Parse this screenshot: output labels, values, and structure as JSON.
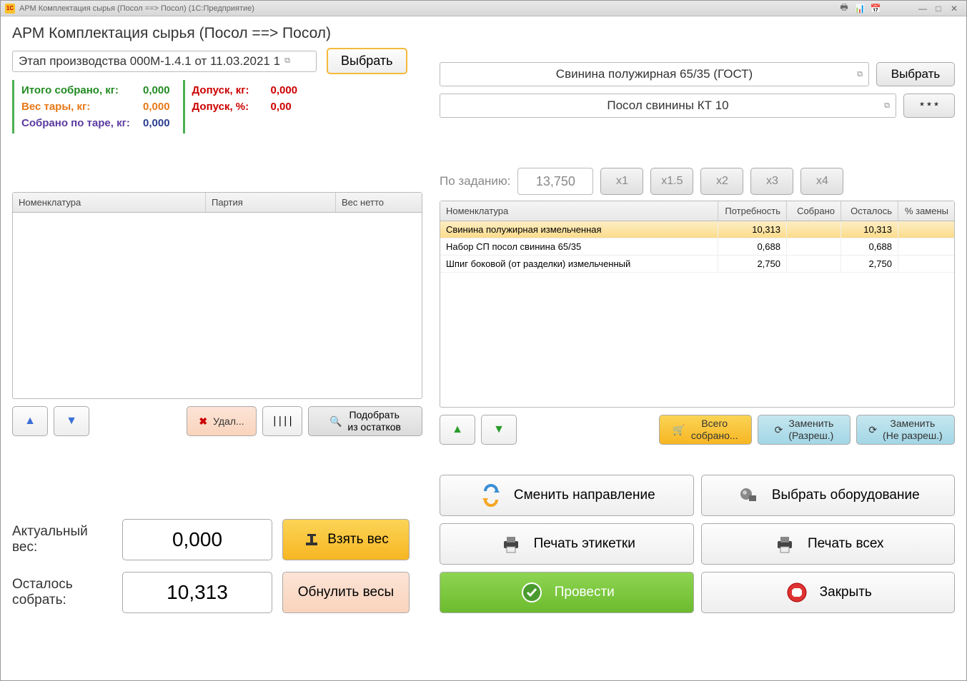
{
  "window": {
    "title": "АРМ Комплектация сырья (Посол ==> Посол)  (1С:Предприятие)"
  },
  "page": {
    "title": "АРМ Комплектация сырья (Посол ==> Посол)"
  },
  "stage": {
    "value": "Этап производства 000М-1.4.1 от 11.03.2021 1",
    "select_btn": "Выбрать"
  },
  "stats": {
    "total_label": "Итого собрано, кг:",
    "total_value": "0,000",
    "tare_label": "Вес тары, кг:",
    "tare_value": "0,000",
    "by_tare_label": "Собрано по таре, кг:",
    "by_tare_value": "0,000",
    "tol_kg_label": "Допуск, кг:",
    "tol_kg_value": "0,000",
    "tol_pct_label": "Допуск, %:",
    "tol_pct_value": "0,00"
  },
  "left_table": {
    "headers": [
      "Номенклатура",
      "Партия",
      "Вес нетто"
    ]
  },
  "left_buttons": {
    "delete": "Удал...",
    "pick": "Подобрать\nиз остатков"
  },
  "right_inputs": {
    "product": "Свинина полужирная 65/35 (ГОСТ)",
    "product_btn": "Выбрать",
    "recipe": "Посол свинины КТ 10",
    "recipe_btn": "* * *"
  },
  "task": {
    "label": "По заданию:",
    "value": "13,750",
    "mult": [
      "x1",
      "x1.5",
      "x2",
      "x3",
      "x4"
    ]
  },
  "right_table": {
    "headers": [
      "Номенклатура",
      "Потребность",
      "Собрано",
      "Осталось",
      "% замены"
    ],
    "rows": [
      {
        "n": "Свинина полужирная измельченная",
        "req": "10,313",
        "col": "",
        "rem": "10,313",
        "pct": ""
      },
      {
        "n": "Набор СП посол свинина 65/35",
        "req": "0,688",
        "col": "",
        "rem": "0,688",
        "pct": ""
      },
      {
        "n": "Шпиг боковой (от разделки) измельченный",
        "req": "2,750",
        "col": "",
        "rem": "2,750",
        "pct": ""
      }
    ]
  },
  "right_buttons": {
    "collected": "Всего\nсобрано...",
    "replace_ok": "Заменить\n(Разреш.)",
    "replace_no": "Заменить\n(Не разреш.)"
  },
  "weight": {
    "actual_label": "Актуальный\nвес:",
    "actual_value": "0,000",
    "take_btn": "Взять вес",
    "remain_label": "Осталось\nсобрать:",
    "remain_value": "10,313",
    "reset_btn": "Обнулить весы"
  },
  "actions": {
    "direction": "Сменить направление",
    "equipment": "Выбрать оборудование",
    "print_label": "Печать этикетки",
    "print_all": "Печать всех",
    "commit": "Провести",
    "close": "Закрыть"
  }
}
